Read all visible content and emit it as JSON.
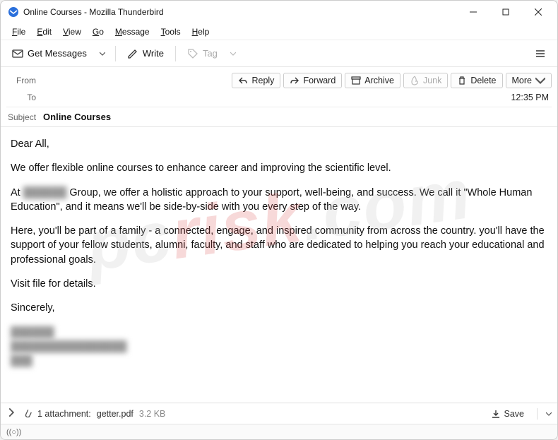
{
  "window": {
    "title": "Online Courses - Mozilla Thunderbird"
  },
  "menu": {
    "file": "File",
    "edit": "Edit",
    "view": "View",
    "go": "Go",
    "message": "Message",
    "tools": "Tools",
    "help": "Help"
  },
  "toolbar": {
    "getmessages": "Get Messages",
    "write": "Write",
    "tag": "Tag"
  },
  "actions": {
    "reply": "Reply",
    "forward": "Forward",
    "archive": "Archive",
    "junk": "Junk",
    "delete": "Delete",
    "more": "More"
  },
  "header": {
    "from_label": "From",
    "to_label": "To",
    "subject_label": "Subject",
    "subject_value": "Online Courses",
    "timestamp": "12:35 PM"
  },
  "body": {
    "p1": "Dear All,",
    "p2": "We offer flexible online courses to enhance career and improving the scientific level.",
    "p3a": "At ",
    "p3b_blur": "██████",
    "p3c": " Group, we offer a holistic approach to your support, well-being, and success. We call it \"Whole Human Education\", and it means we'll be side-by-side with you every step of the way.",
    "p4": "Here, you'll be part of a family - a connected, engage, and inspired community from across the country. you'll have the support of your fellow students, alumni, faculty, and staff who are dedicated to helping you reach your educational and professional goals.",
    "p5": "Visit file for details.",
    "p6": "Sincerely,",
    "sig1": "██████",
    "sig2": "████████████████",
    "sig3": "███"
  },
  "attachment": {
    "count_label": "1 attachment:",
    "filename": "getter.pdf",
    "size": "3.2 KB",
    "save": "Save"
  },
  "status": {
    "indicator": "((○))"
  },
  "watermark": {
    "part1": "pc",
    "part2": "risk",
    "part3": ".com"
  }
}
